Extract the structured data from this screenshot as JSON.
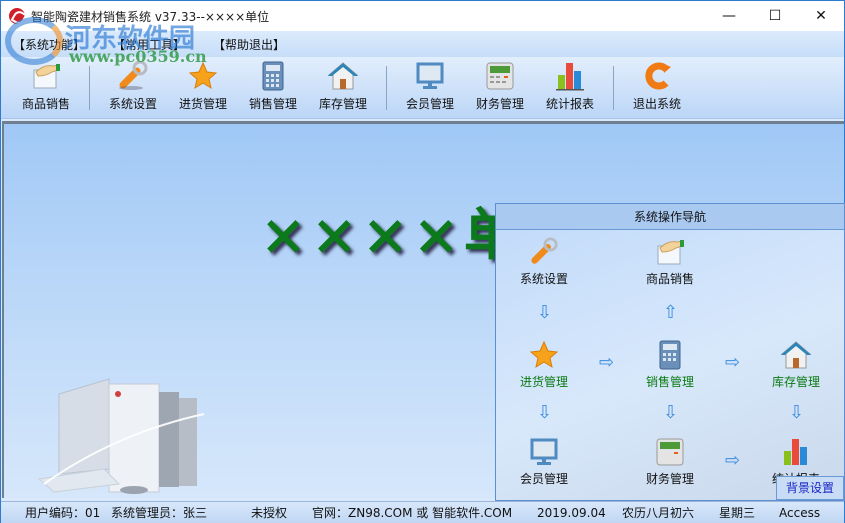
{
  "window": {
    "title": "智能陶瓷建材销售系统 v37.33--××××单位",
    "controls": {
      "minimize": "—",
      "maximize": "☐",
      "close": "✕"
    }
  },
  "watermark": {
    "site_name": "河东软件园",
    "url": "www.pc0359.cn"
  },
  "menu": [
    {
      "label": "【系统功能】"
    },
    {
      "label": "【常用工具】"
    },
    {
      "label": "【帮助退出】"
    }
  ],
  "toolbar": [
    {
      "label": "商品销售",
      "icon": "hand-sale-icon"
    },
    {
      "label": "系统设置",
      "icon": "wrench-icon"
    },
    {
      "label": "进货管理",
      "icon": "star-icon"
    },
    {
      "label": "销售管理",
      "icon": "calculator-icon"
    },
    {
      "label": "库存管理",
      "icon": "house-icon"
    },
    {
      "label": "会员管理",
      "icon": "monitor-icon"
    },
    {
      "label": "财务管理",
      "icon": "cash-register-icon"
    },
    {
      "label": "统计报表",
      "icon": "bar-chart-icon"
    },
    {
      "label": "退出系统",
      "icon": "exit-icon"
    }
  ],
  "main": {
    "big_title": "××××单位"
  },
  "nav_panel": {
    "title": "系统操作导航",
    "items": {
      "system_settings": "系统设置",
      "product_sales": "商品销售",
      "purchase": "进货管理",
      "sales": "销售管理",
      "inventory": "库存管理",
      "members": "会员管理",
      "finance": "财务管理",
      "reports": "统计报表"
    },
    "background_button": "背景设置"
  },
  "status": {
    "user_code": "用户编码：01",
    "admin": "系统管理员：张三",
    "license": "未授权",
    "website": "官网：ZN98.COM 或 智能软件.COM",
    "date": "2019.09.04",
    "lunar": "农历八月初六",
    "weekday": "星期三",
    "db": "Access"
  },
  "colors": {
    "accent_green": "#0a7a12",
    "link_blue": "#1a24c8",
    "panel_blue": "#a9c9f1"
  }
}
